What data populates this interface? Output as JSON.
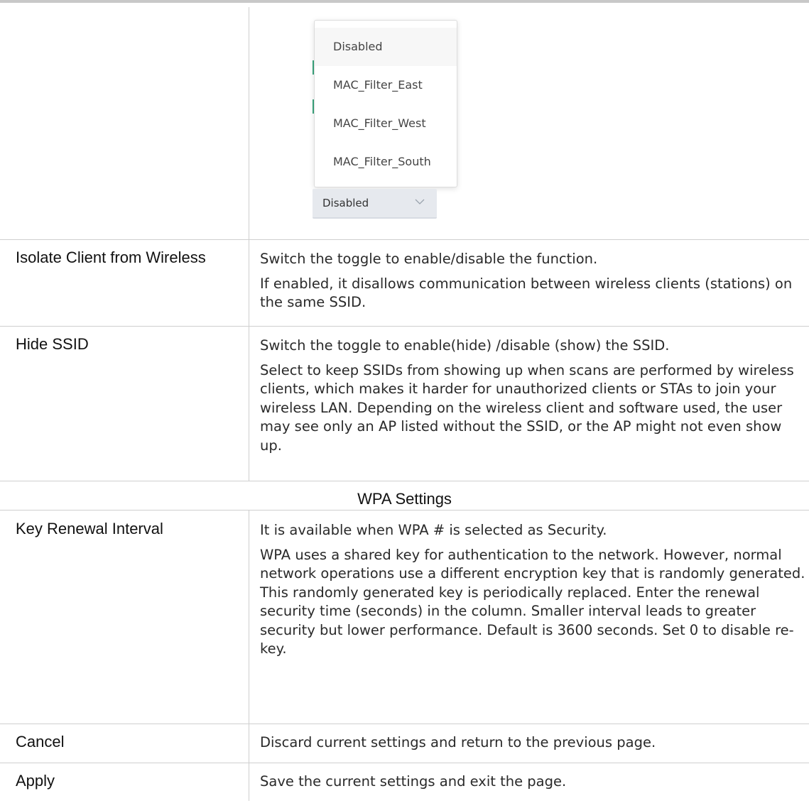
{
  "dropdown": {
    "options": [
      "Disabled",
      "MAC_Filter_East",
      "MAC_Filter_West",
      "MAC_Filter_South"
    ],
    "selected_value": "Disabled",
    "chevron_icon": "chevron-down-icon",
    "accent_color": "#3aa57d"
  },
  "rows": [
    {
      "label": "Isolate Client from Wireless",
      "desc": [
        "Switch the toggle to enable/disable the function.",
        "If enabled, it disallows communication between wireless clients (stations) on the same SSID."
      ]
    },
    {
      "label": "Hide SSID",
      "desc": [
        "Switch the toggle to enable(hide) /disable (show) the SSID.",
        "Select to keep SSIDs from showing up when scans are performed by wireless clients, which makes it harder for unauthorized clients or STAs to join your wireless LAN. Depending on the wireless client and software used, the user may see only an AP listed without the SSID, or the AP might not even show up."
      ]
    }
  ],
  "section_title": "WPA Settings",
  "rows2": [
    {
      "label": "Key Renewal Interval",
      "desc": [
        "It is available when WPA # is selected as Security.",
        "WPA uses a shared key for authentication to the network. However, normal network operations use a different encryption key that is randomly generated. This randomly generated key is periodically replaced. Enter the renewal security time (seconds) in the column. Smaller interval leads to greater security but lower performance. Default is 3600 seconds. Set 0 to disable re-key."
      ]
    },
    {
      "label": "Cancel",
      "desc": [
        "Discard current settings and return to the previous page."
      ]
    },
    {
      "label": "Apply",
      "desc": [
        "Save the current settings and exit the page."
      ]
    }
  ]
}
